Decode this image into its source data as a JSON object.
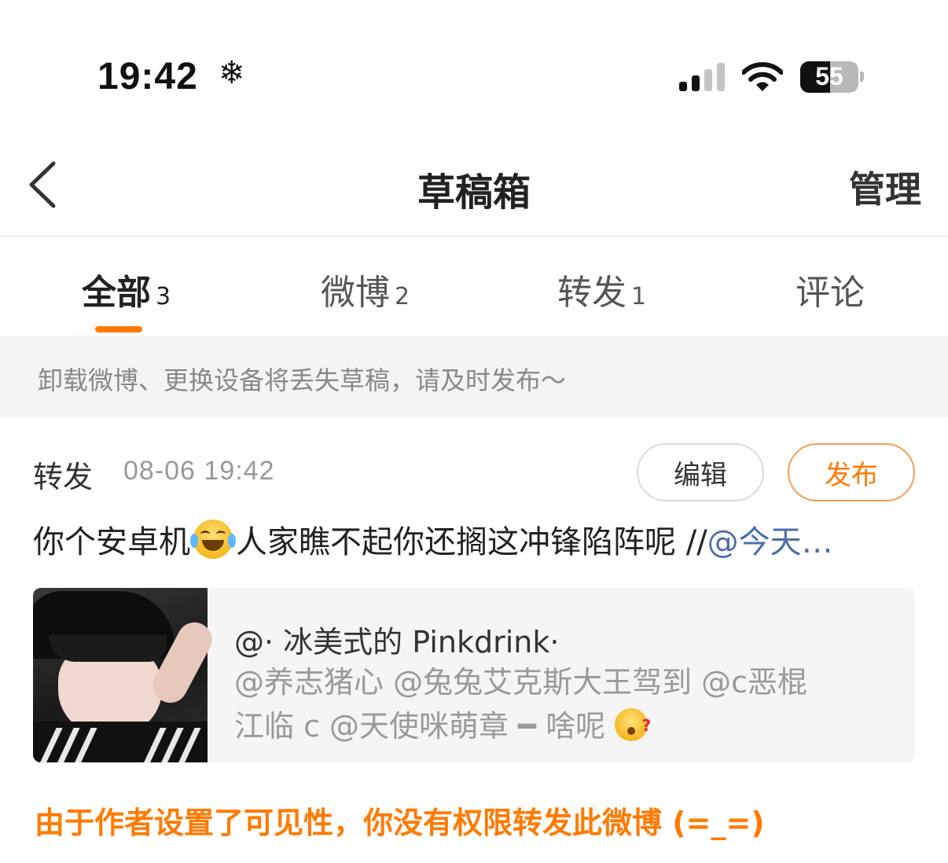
{
  "status": {
    "time": "19:42",
    "time_icon": "❄",
    "battery": "55"
  },
  "header": {
    "title": "草稿箱",
    "manage_label": "管理"
  },
  "tabs": [
    {
      "label": "全部",
      "count": "3",
      "active": true
    },
    {
      "label": "微博",
      "count": "2",
      "active": false
    },
    {
      "label": "转发",
      "count": "1",
      "active": false
    },
    {
      "label": "评论",
      "count": "",
      "active": false
    }
  ],
  "notice": "卸载微博、更换设备将丢失草稿，请及时发布～",
  "draft": {
    "type": "转发",
    "date": "08-06 19:42",
    "edit_label": "编辑",
    "publish_label": "发布",
    "content_before": "你个安卓机",
    "content_after": "人家瞧不起你还搁这冲锋陷阵呢 //",
    "content_mention": "@今天…",
    "quote": {
      "author": "@· 冰美式的 Pinkdrink·",
      "text_line1": "@养志猪心 @兔兔艾克斯大王驾到 @c恶棍",
      "text_line2": "江临 c @天使咪萌章 ━ 啥呢"
    },
    "warning": "由于作者设置了可见性，你没有权限转发此微博 (=_=)"
  },
  "colors": {
    "accent": "#ff7a00",
    "mention": "#4b6fa8"
  }
}
